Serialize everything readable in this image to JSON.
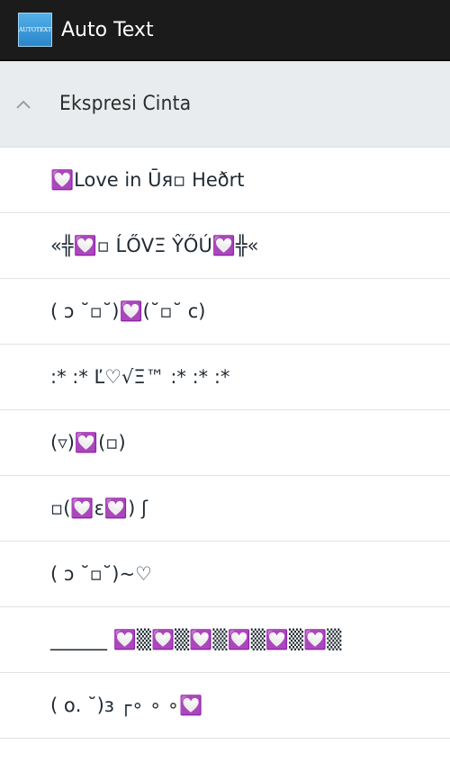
{
  "action_bar": {
    "icon_label": "AUTOTEXT",
    "title": "Auto Text"
  },
  "group": {
    "title": "Ekspresi Cinta",
    "expanded": true
  },
  "items": [
    "💟Love in Ūя▫ Heðrt",
    "«╬💟▫ ĹŐVΞ ŶŐÚ💟╬«",
    "( ɔ ˘▫˘)💟(˘▫˘ c)",
    ":* :* Ľ♡√Ξ™ :* :* :*",
    "(▿)💟(▫)",
    "▫(💟ε💟) ʃ",
    "( ɔ ˘▫˘)~♡",
    "______ 💟▒💟▒💟▒💟▒💟▒💟▒",
    "( ο. ˘)з ┌∘ ∘ ∘💟"
  ]
}
